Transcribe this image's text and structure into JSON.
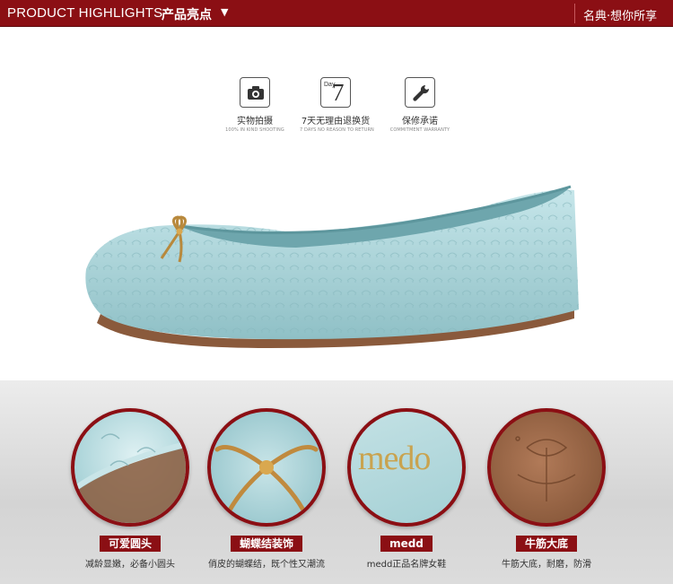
{
  "header": {
    "title_en": "PRODUCT HIGHLIGHTS",
    "title_cn": "产品亮点",
    "caret": "▼",
    "slogan": "名典·想你所享"
  },
  "badges": [
    {
      "icon": "camera-icon",
      "label": "实物拍摄",
      "sub": "100% IN KIND SHOOTING"
    },
    {
      "icon": "day7-icon",
      "icon_text_small": "Day",
      "icon_text_big": "7",
      "label": "7天无理由退换货",
      "sub": "7 DAYS NO REASON TO RETURN"
    },
    {
      "icon": "wrench-icon",
      "label": "保修承诺",
      "sub": "COMMITMENT WARRANTY"
    }
  ],
  "product": {
    "icon": "ballet-flat-shoe-image",
    "color": "#a9d3d8"
  },
  "features": [
    {
      "icon": "embossed-toe-closeup",
      "tag": "可爱圆头",
      "desc": "减龄显嫩，必备小圆头"
    },
    {
      "icon": "bow-knot-closeup",
      "tag": "蝴蝶结装饰",
      "desc": "俏皮的蝴蝶结，既个性又潮流"
    },
    {
      "icon": "insole-logo-closeup",
      "logo_text": "medo",
      "tag": "medd",
      "desc": "medd正品名牌女鞋"
    },
    {
      "icon": "sole-closeup",
      "tag": "牛筋大底",
      "desc": "牛筋大底，耐磨，防滑"
    }
  ],
  "colors": {
    "accent": "#8b0f14",
    "shoe": "#a9d3d8",
    "sole": "#8a5a3c"
  }
}
